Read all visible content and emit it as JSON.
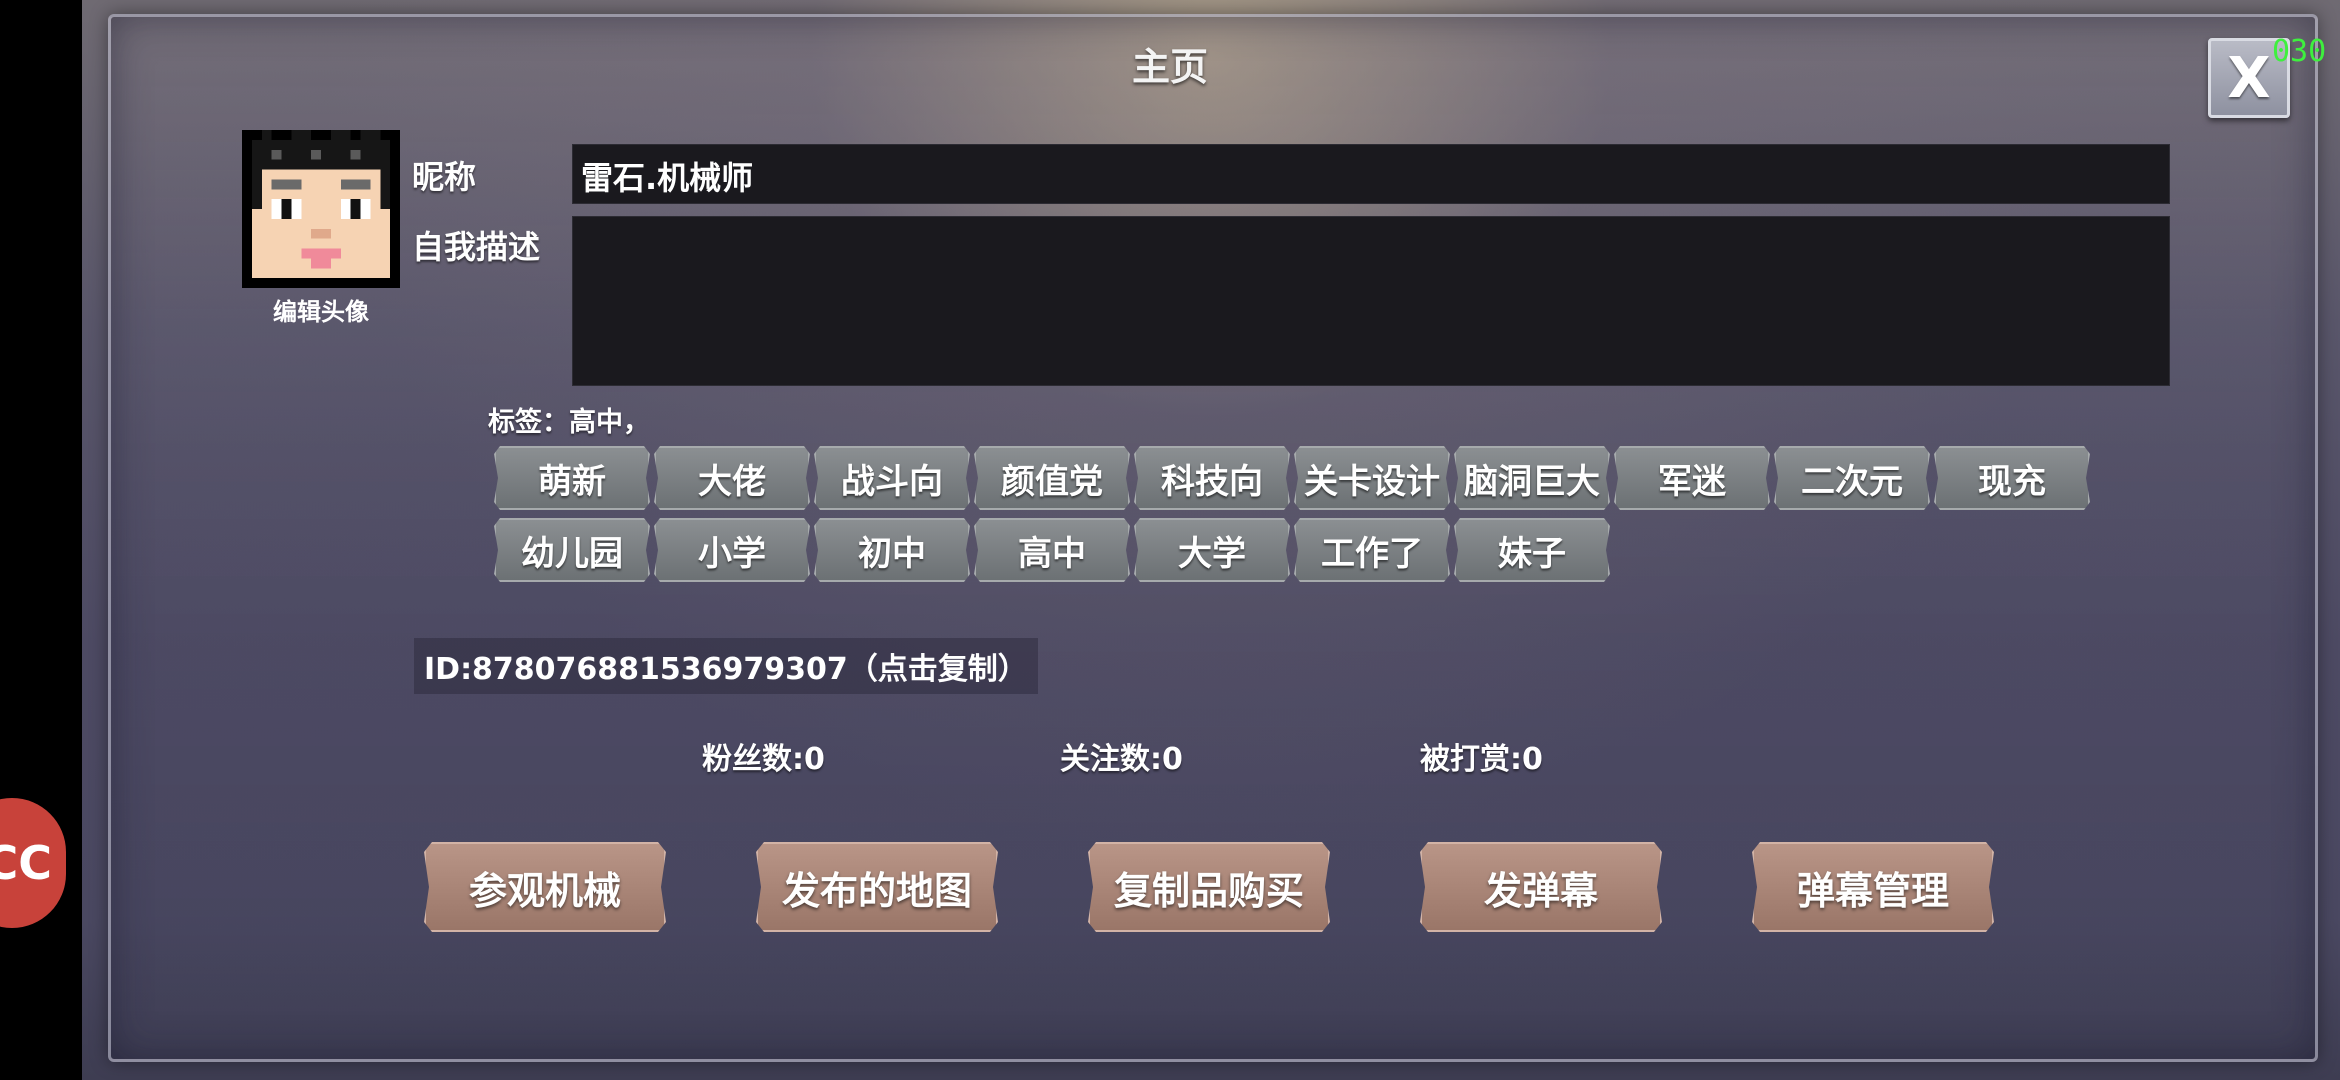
{
  "title": "主页",
  "close_label": "X",
  "fps_counter": "030",
  "side_badge": "CC",
  "profile": {
    "avatar_caption": "编辑头像",
    "nickname_label": "昵称",
    "nickname_value": "雷石.机械师",
    "description_label": "自我描述",
    "description_value": "",
    "tags_line": "标签：高中，"
  },
  "tags_row1": [
    "萌新",
    "大佬",
    "战斗向",
    "颜值党",
    "科技向",
    "关卡设计",
    "脑洞巨大",
    "军迷",
    "二次元",
    "现充"
  ],
  "tags_row2": [
    "幼儿园",
    "小学",
    "初中",
    "高中",
    "大学",
    "工作了",
    "妹子"
  ],
  "user_id": "ID:878076881536979307（点击复制）",
  "stats": {
    "fans": "粉丝数:0",
    "following": "关注数:0",
    "tipped": "被打赏:0"
  },
  "actions": [
    "参观机械",
    "发布的地图",
    "复制品购买",
    "发弹幕",
    "弹幕管理"
  ],
  "colors": {
    "fps": "#3ef03e",
    "action_button": "#a9857a",
    "tag_button": "#7c8083",
    "field_bg": "#1a191e"
  }
}
